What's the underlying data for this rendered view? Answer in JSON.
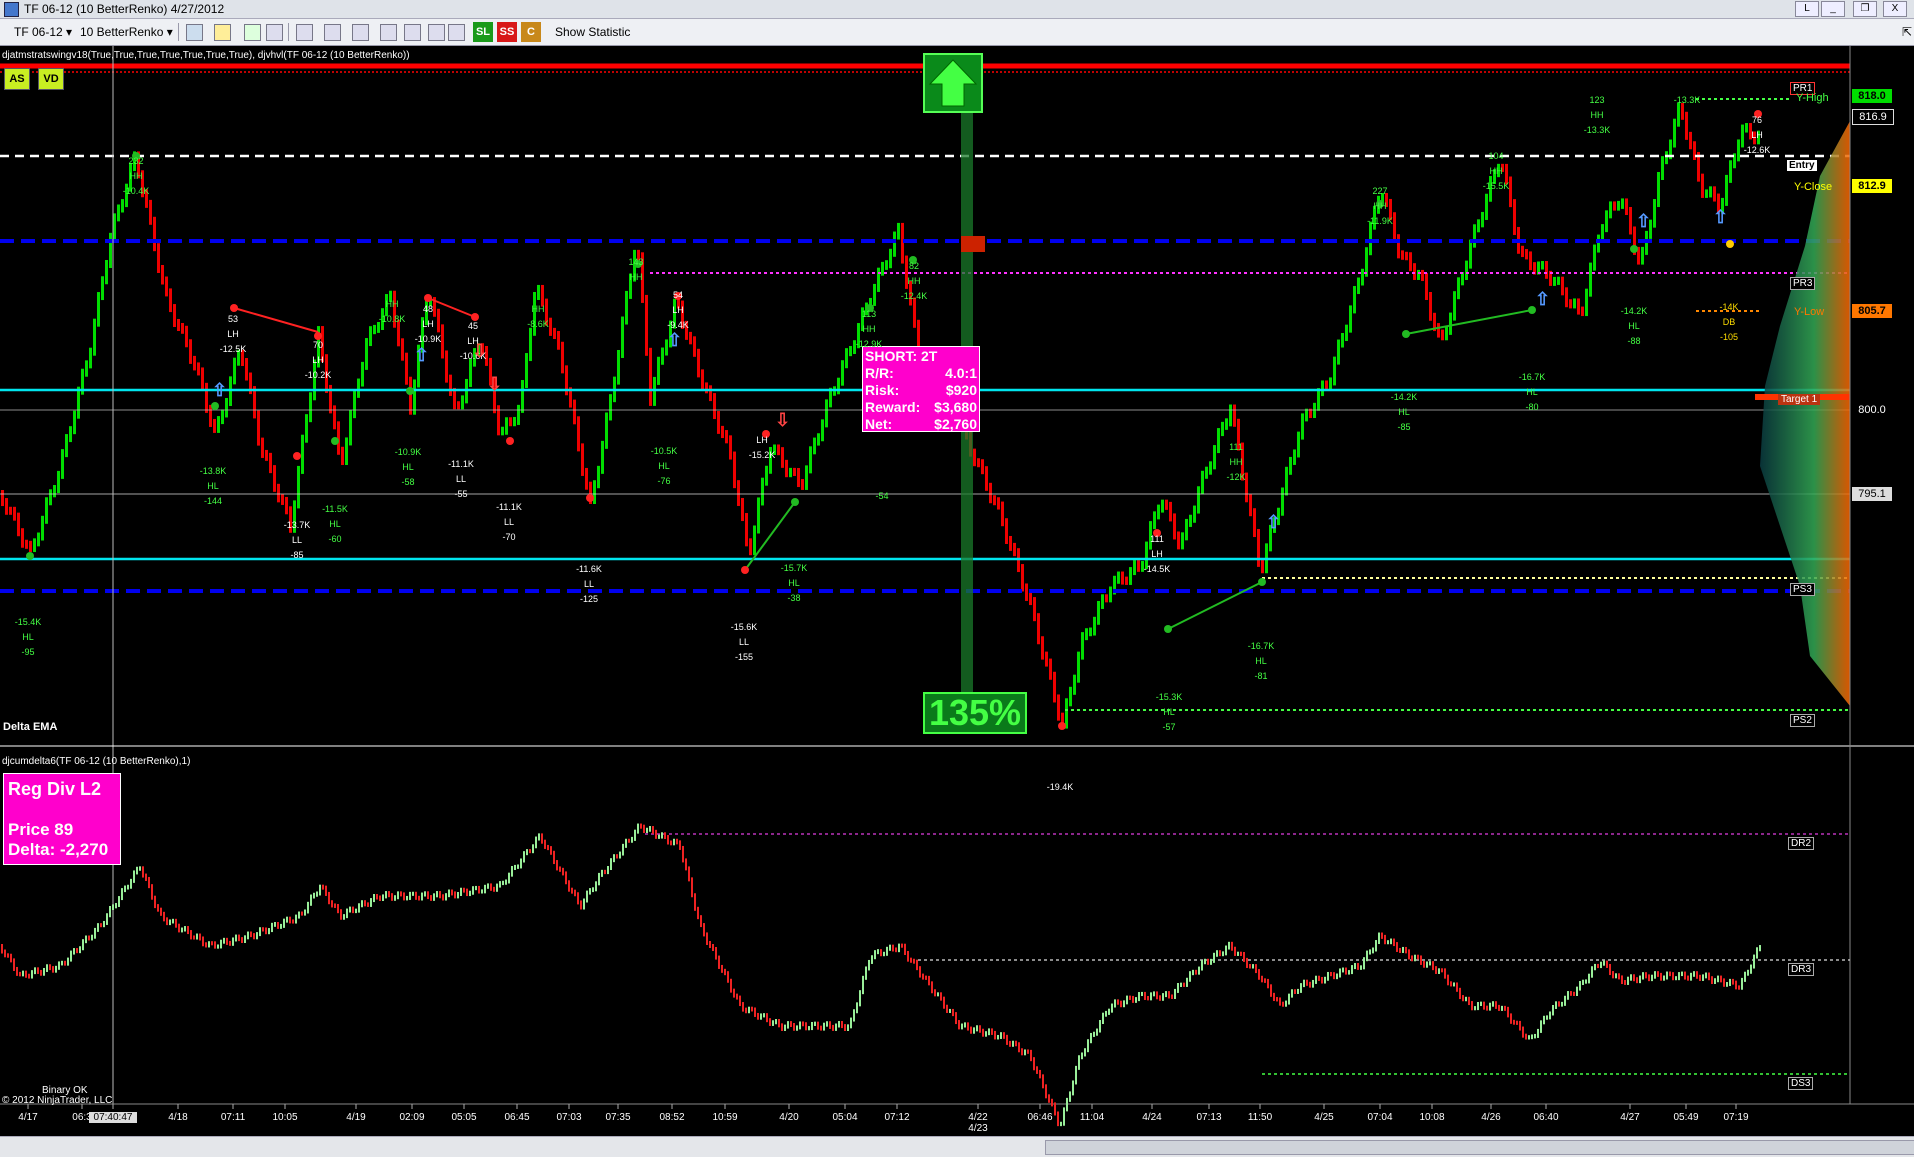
{
  "window": {
    "title": "TF 06-12 (10 BetterRenko)  4/27/2012",
    "buttons": [
      "L",
      "_",
      "❐",
      "X"
    ]
  },
  "toolbar": {
    "instrument": "TF 06-12",
    "bartype": "10 BetterRenko",
    "sl": "SL",
    "ss": "SS",
    "c": "C",
    "show_statistic": "Show Statistic"
  },
  "colors": {
    "background": "#000000",
    "up_bar": "#00dd00",
    "down_bar": "#ee0000",
    "resistance": "#ff0000",
    "pivot_blue": "#0000ee",
    "cyan_line": "#00e5ee",
    "magenta": "#ff00ff",
    "yellow": "#ffff00"
  },
  "price_panel": {
    "indicator_title": "djatmstratswingv18(True,True,True,True,True,True,True), djvhvl(TF 06-12 (10 BetterRenko))",
    "badge_as": "AS",
    "badge_vd": "VD",
    "delta_ema_label": "Delta EMA",
    "pct_label": "135%",
    "trade_box": [
      {
        "k": "SHORT: 2T",
        "v": ""
      },
      {
        "k": "R/R:",
        "v": "4.0:1"
      },
      {
        "k": "Risk:",
        "v": "$920"
      },
      {
        "k": "Reward:",
        "v": "$3,680"
      },
      {
        "k": "Net:",
        "v": "$2,760"
      }
    ],
    "price_axis": [
      "818.0",
      "816.9",
      "812.9",
      "805.7",
      "800.0",
      "795.1"
    ],
    "right_labels": [
      "PR1",
      "Y-High",
      "Entry",
      "Y-Close",
      "PR3",
      "Y-Low",
      "Target 1",
      "PS3",
      "PS2"
    ]
  },
  "delta_panel": {
    "indicator_title": "djcumdelta6(TF 06-12 (10 BetterRenko),1)",
    "box_title": "Reg Div L2",
    "box_price": "Price  89",
    "box_delta": "Delta: -2,270",
    "right_labels": [
      "DR2",
      "DR3",
      "DS3"
    ],
    "footer_status": "Binary OK",
    "copyright": "© 2012 NinjaTrader, LLC"
  },
  "time_axis": [
    "4/17",
    "06:3",
    "07:40:47",
    "4/18",
    "07:11",
    "10:05",
    "4/19",
    "02:09",
    "05:05",
    "06:45",
    "07:03",
    "07:35",
    "08:52",
    "10:59",
    "4/20",
    "05:04",
    "07:12",
    "4/22 4/23",
    "06:46",
    "11:04",
    "4/24",
    "07:13",
    "11:50",
    "4/25",
    "07:04",
    "10:08",
    "4/26",
    "06:40",
    "4/27",
    "05:49",
    "07:19"
  ],
  "swing_labels": [
    {
      "t": "232"
    },
    {
      "t": "HH"
    },
    {
      "t": "-10.4K"
    },
    {
      "t": "53"
    },
    {
      "t": "LH"
    },
    {
      "t": "-12.5K"
    },
    {
      "t": "70"
    },
    {
      "t": "LH"
    },
    {
      "t": "-10.2K"
    },
    {
      "t": "HH"
    },
    {
      "t": "-10.8K"
    },
    {
      "t": "48"
    },
    {
      "t": "LH"
    },
    {
      "t": "-10.9K"
    },
    {
      "t": "45"
    },
    {
      "t": "LH"
    },
    {
      "t": "-10.6K"
    },
    {
      "t": "HH"
    },
    {
      "t": "-8.6K"
    },
    {
      "t": "143"
    },
    {
      "t": "HH"
    },
    {
      "t": "54"
    },
    {
      "t": "LH"
    },
    {
      "t": "-9.4K"
    },
    {
      "t": "82"
    },
    {
      "t": "HH"
    },
    {
      "t": "-12.4K"
    },
    {
      "t": "113"
    },
    {
      "t": "HH"
    },
    {
      "t": "-12.9K"
    },
    {
      "t": "-13.8K"
    },
    {
      "t": "HL"
    },
    {
      "t": "-144"
    },
    {
      "t": "-10.9K"
    },
    {
      "t": "HL"
    },
    {
      "t": "-58"
    },
    {
      "t": "-11.1K"
    },
    {
      "t": "LL"
    },
    {
      "t": "-55"
    },
    {
      "t": "-13.7K"
    },
    {
      "t": "LL"
    },
    {
      "t": "-85"
    },
    {
      "t": "-11.5K"
    },
    {
      "t": "HL"
    },
    {
      "t": "-60"
    },
    {
      "t": "-11.1K"
    },
    {
      "t": "LL"
    },
    {
      "t": "-70"
    },
    {
      "t": "-15.4K"
    },
    {
      "t": "HL"
    },
    {
      "t": "-95"
    },
    {
      "t": "-11.6K"
    },
    {
      "t": "LL"
    },
    {
      "t": "-125"
    },
    {
      "t": "-10.5K"
    },
    {
      "t": "HL"
    },
    {
      "t": "-76"
    },
    {
      "t": "LH"
    },
    {
      "t": "-15.2K"
    },
    {
      "t": "-15.7K"
    },
    {
      "t": "HL"
    },
    {
      "t": "-38"
    },
    {
      "t": "-15.6K"
    },
    {
      "t": "LL"
    },
    {
      "t": "-155"
    },
    {
      "t": "-54"
    },
    {
      "t": "111"
    },
    {
      "t": "LH"
    },
    {
      "t": "-14.5K"
    },
    {
      "t": "111"
    },
    {
      "t": "HH"
    },
    {
      "t": "-12K"
    },
    {
      "t": "-15.3K"
    },
    {
      "t": "HL"
    },
    {
      "t": "-57"
    },
    {
      "t": "-16.7K"
    },
    {
      "t": "HL"
    },
    {
      "t": "-81"
    },
    {
      "t": "-19.4K"
    },
    {
      "t": "227"
    },
    {
      "t": "HH"
    },
    {
      "t": "-11.9K"
    },
    {
      "t": "104"
    },
    {
      "t": "HH"
    },
    {
      "t": "-15.5K"
    },
    {
      "t": "-14.2K"
    },
    {
      "t": "HL"
    },
    {
      "t": "-85"
    },
    {
      "t": "-16.7K"
    },
    {
      "t": "HL"
    },
    {
      "t": "-80"
    },
    {
      "t": "123"
    },
    {
      "t": "HH"
    },
    {
      "t": "-13.3K"
    },
    {
      "t": "-13.3K"
    },
    {
      "t": "-14.2K"
    },
    {
      "t": "HL"
    },
    {
      "t": "-88"
    },
    {
      "t": "76"
    },
    {
      "t": "LH"
    },
    {
      "t": "-12.6K"
    },
    {
      "t": "-14K"
    },
    {
      "t": "DB"
    },
    {
      "t": "-105"
    }
  ]
}
